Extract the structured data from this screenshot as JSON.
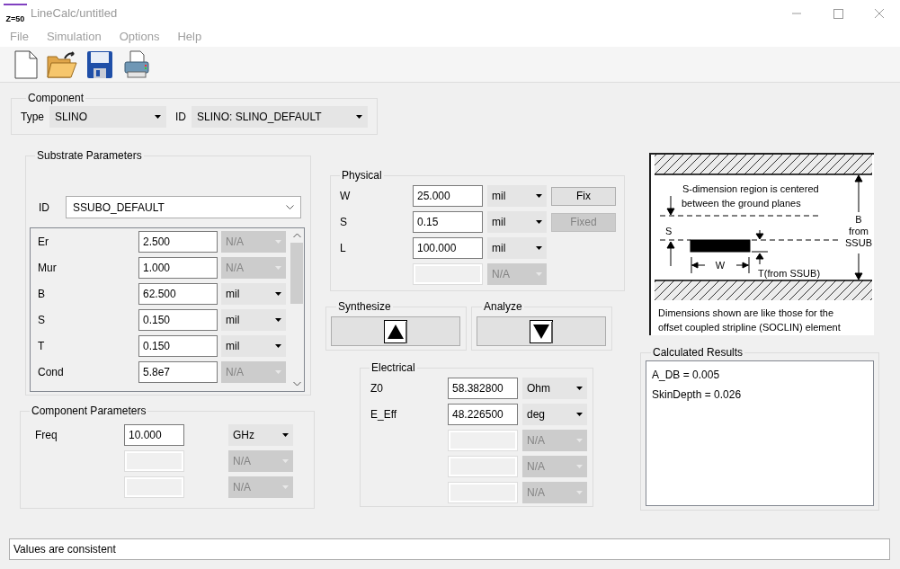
{
  "window": {
    "title": "LineCalc/untitled",
    "icon_label": "Z=50"
  },
  "menu": [
    {
      "label": "File"
    },
    {
      "label": "Simulation"
    },
    {
      "label": "Options"
    },
    {
      "label": "Help"
    }
  ],
  "toolbar": [
    {
      "kind": "new"
    },
    {
      "kind": "open"
    },
    {
      "kind": "save"
    },
    {
      "kind": "print"
    }
  ],
  "component": {
    "title": "Component",
    "type_label": "Type",
    "type_value": "SLINO",
    "id_label": "ID",
    "id_value": "SLINO: SLINO_DEFAULT"
  },
  "substrate": {
    "title": "Substrate Parameters",
    "id_label": "ID",
    "id_value": "SSUBO_DEFAULT",
    "rows": [
      {
        "label": "Er",
        "value": "2.500",
        "enabled": true,
        "unit": "N/A",
        "unit_enabled": false
      },
      {
        "label": "Mur",
        "value": "1.000",
        "enabled": true,
        "unit": "N/A",
        "unit_enabled": false
      },
      {
        "label": "B",
        "value": "62.500",
        "enabled": true,
        "unit": "mil",
        "unit_enabled": true
      },
      {
        "label": "S",
        "value": "0.150",
        "enabled": true,
        "unit": "mil",
        "unit_enabled": true
      },
      {
        "label": "T",
        "value": "0.150",
        "enabled": true,
        "unit": "mil",
        "unit_enabled": true
      },
      {
        "label": "Cond",
        "value": "5.8e7",
        "enabled": true,
        "unit": "N/A",
        "unit_enabled": false
      }
    ]
  },
  "component_parameters": {
    "title": "Component Parameters",
    "rows": [
      {
        "label": "Freq",
        "value": "10.000",
        "enabled": true,
        "unit": "GHz",
        "unit_enabled": true
      },
      {
        "enabled": false,
        "unit": "N/A",
        "unit_enabled": false
      },
      {
        "enabled": false,
        "unit": "N/A",
        "unit_enabled": false
      }
    ]
  },
  "physical": {
    "title": "Physical",
    "rows": [
      {
        "label": "W",
        "value": "25.000",
        "enabled": true,
        "unit": "mil",
        "unit_enabled": true,
        "button": {
          "label": "Fix",
          "disabled": false
        }
      },
      {
        "label": "S",
        "value": "0.15",
        "enabled": true,
        "unit": "mil",
        "unit_enabled": true,
        "button": {
          "label": "Fixed",
          "disabled": true
        }
      },
      {
        "label": "L",
        "value": "100.000",
        "enabled": true,
        "unit": "mil",
        "unit_enabled": true
      },
      {
        "enabled": false,
        "unit": "N/A",
        "unit_enabled": false
      }
    ]
  },
  "synthesize": {
    "title": "Synthesize"
  },
  "analyze": {
    "title": "Analyze"
  },
  "electrical": {
    "title": "Electrical",
    "rows": [
      {
        "label": "Z0",
        "value": "58.382800",
        "enabled": true,
        "unit": "Ohm",
        "unit_enabled": true
      },
      {
        "label": "E_Eff",
        "value": "48.226500",
        "enabled": true,
        "unit": "deg",
        "unit_enabled": true
      },
      {
        "enabled": false,
        "unit": "N/A",
        "unit_enabled": false
      },
      {
        "enabled": false,
        "unit": "N/A",
        "unit_enabled": false
      },
      {
        "enabled": false,
        "unit": "N/A",
        "unit_enabled": false
      }
    ]
  },
  "diagram": {
    "note_lines": [
      "S-dimension region is centered",
      "between the ground planes"
    ],
    "s_label": "S",
    "b_label": "B",
    "from_lines": [
      "from",
      "SSUB"
    ],
    "w_label": "W",
    "t_label": "T(from SSUB)",
    "caption_lines": [
      "Dimensions shown are like those for the",
      "offset coupled stripline (SOCLIN) element"
    ]
  },
  "results": {
    "title": "Calculated Results",
    "lines": [
      "A_DB = 0.005",
      "SkinDepth = 0.026"
    ]
  },
  "status": "Values are consistent"
}
